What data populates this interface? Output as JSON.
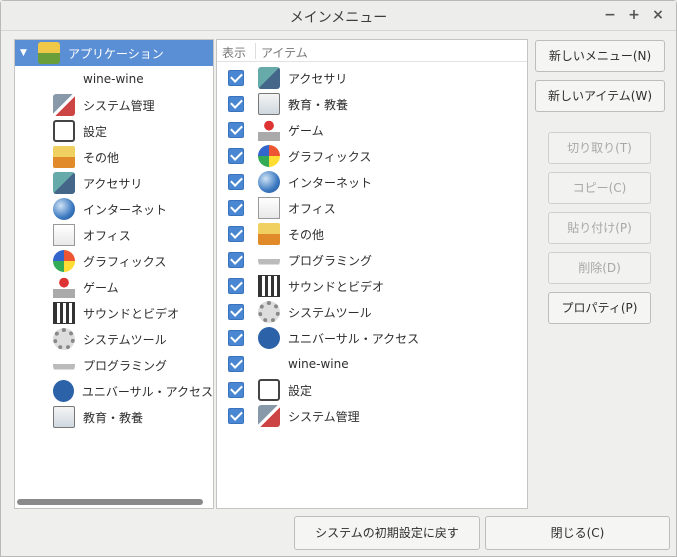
{
  "window": {
    "title": "メインメニュー",
    "minimize": "−",
    "maximize": "+",
    "close": "×"
  },
  "tree": {
    "items": [
      {
        "label": "アプリケーション",
        "icon": "applications-icon",
        "selected": true,
        "expanded": true
      },
      {
        "label": "wine-wine",
        "icon": "none"
      },
      {
        "label": "システム管理",
        "icon": "system-admin-icon"
      },
      {
        "label": "設定",
        "icon": "settings-icon"
      },
      {
        "label": "その他",
        "icon": "other-icon"
      },
      {
        "label": "アクセサリ",
        "icon": "accessories-icon"
      },
      {
        "label": "インターネット",
        "icon": "internet-icon"
      },
      {
        "label": "オフィス",
        "icon": "office-icon"
      },
      {
        "label": "グラフィックス",
        "icon": "graphics-icon"
      },
      {
        "label": "ゲーム",
        "icon": "games-icon"
      },
      {
        "label": "サウンドとビデオ",
        "icon": "sound-video-icon"
      },
      {
        "label": "システムツール",
        "icon": "system-tools-icon"
      },
      {
        "label": "プログラミング",
        "icon": "programming-icon"
      },
      {
        "label": "ユニバーサル・アクセス",
        "icon": "universal-access-icon"
      },
      {
        "label": "教育・教養",
        "icon": "education-icon"
      }
    ]
  },
  "list": {
    "col_show": "表示",
    "col_item": "アイテム",
    "items": [
      {
        "label": "アクセサリ",
        "icon": "accessories-icon",
        "checked": true
      },
      {
        "label": "教育・教養",
        "icon": "education-icon",
        "checked": true
      },
      {
        "label": "ゲーム",
        "icon": "games-icon",
        "checked": true
      },
      {
        "label": "グラフィックス",
        "icon": "graphics-icon",
        "checked": true
      },
      {
        "label": "インターネット",
        "icon": "internet-icon",
        "checked": true
      },
      {
        "label": "オフィス",
        "icon": "office-icon",
        "checked": true
      },
      {
        "label": "その他",
        "icon": "other-icon",
        "checked": true
      },
      {
        "label": "プログラミング",
        "icon": "programming-icon",
        "checked": true
      },
      {
        "label": "サウンドとビデオ",
        "icon": "sound-video-icon",
        "checked": true
      },
      {
        "label": "システムツール",
        "icon": "system-tools-icon",
        "checked": true
      },
      {
        "label": "ユニバーサル・アクセス",
        "icon": "universal-access-icon",
        "checked": true
      },
      {
        "label": "wine-wine",
        "icon": "none",
        "checked": true
      },
      {
        "label": "設定",
        "icon": "settings-icon",
        "checked": true
      },
      {
        "label": "システム管理",
        "icon": "system-admin-icon",
        "checked": true
      }
    ]
  },
  "buttons": {
    "new_menu": "新しいメニュー(N)",
    "new_item": "新しいアイテム(W)",
    "cut": "切り取り(T)",
    "copy": "コピー(C)",
    "paste": "貼り付け(P)",
    "delete": "削除(D)",
    "properties": "プロパティ(P)",
    "revert": "システムの初期設定に戻す",
    "close": "閉じる(C)"
  }
}
